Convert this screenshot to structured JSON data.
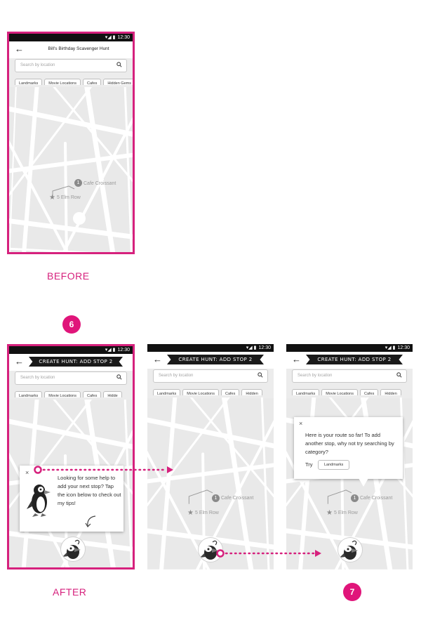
{
  "status_bar": {
    "time": "12:30",
    "icons": "▾◢ ▮"
  },
  "app": {
    "back_label": "←",
    "before_title": "Bill's Birthday Scavenger Hunt",
    "after_title": "CREATE HUNT: ADD STOP 2"
  },
  "search": {
    "placeholder": "Search by location"
  },
  "categories": {
    "landmarks": "Landmarks",
    "movie_locations": "Movie Locations",
    "cafes": "Cafes",
    "hidden_gems": "Hidden Gems",
    "hidden_gems_clip_after": "Hidde",
    "hidden_gems_clip_mid": "Hidden"
  },
  "map": {
    "stop_number": "1",
    "cafe_name": "Cafe Croissant",
    "start_address": "5 Elm Row"
  },
  "tip_popup": {
    "close": "×",
    "text": "Looking for some help to add your next stop? Tap the icon below to check out my tips!"
  },
  "route_popup": {
    "close": "×",
    "text": "Here is your route so far! To add another stop, why not try searching by category?",
    "try_label": "Try",
    "try_chip": "Landmarks"
  },
  "captions": {
    "before": "BEFORE",
    "after": "AFTER"
  },
  "steps": {
    "six": "6",
    "seven": "7"
  },
  "colors": {
    "accent": "#d6217d",
    "step_badge": "#e0157a",
    "banner": "#1a1a1a"
  }
}
